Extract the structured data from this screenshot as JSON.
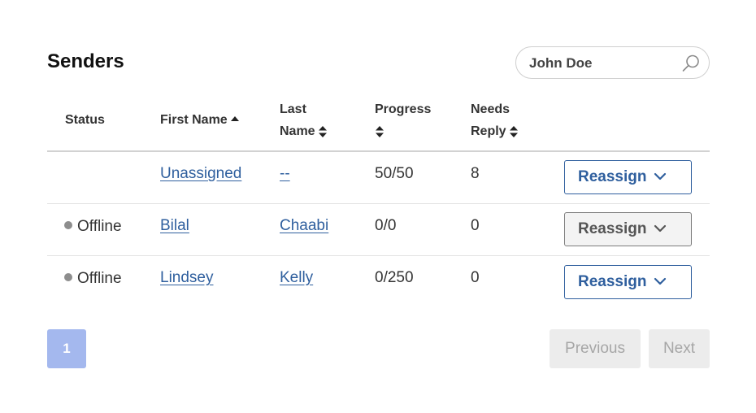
{
  "page": {
    "title": "Senders"
  },
  "search": {
    "value": "John Doe",
    "icon": "search-icon"
  },
  "columns": {
    "status": "Status",
    "first_name": "First Name",
    "last_name_1": "Last",
    "last_name_2": "Name",
    "progress": "Progress",
    "needs_reply_1": "Needs",
    "needs_reply_2": "Reply"
  },
  "rows": [
    {
      "status": "",
      "first_name": "Unassigned",
      "last_name": "--",
      "progress": "50/50",
      "needs_reply": "8",
      "action": "Reassign"
    },
    {
      "status": "Offline",
      "first_name": "Bilal",
      "last_name": "Chaabi",
      "progress": "0/0",
      "needs_reply": "0",
      "action": "Reassign"
    },
    {
      "status": "Offline",
      "first_name": "Lindsey",
      "last_name": "Kelly",
      "progress": "0/250",
      "needs_reply": "0",
      "action": "Reassign"
    }
  ],
  "pagination": {
    "current": "1",
    "previous": "Previous",
    "next": "Next"
  },
  "colors": {
    "link": "#2f5f9e",
    "page_active": "#a4b8ee",
    "status_offline": "#8d8d8d"
  }
}
